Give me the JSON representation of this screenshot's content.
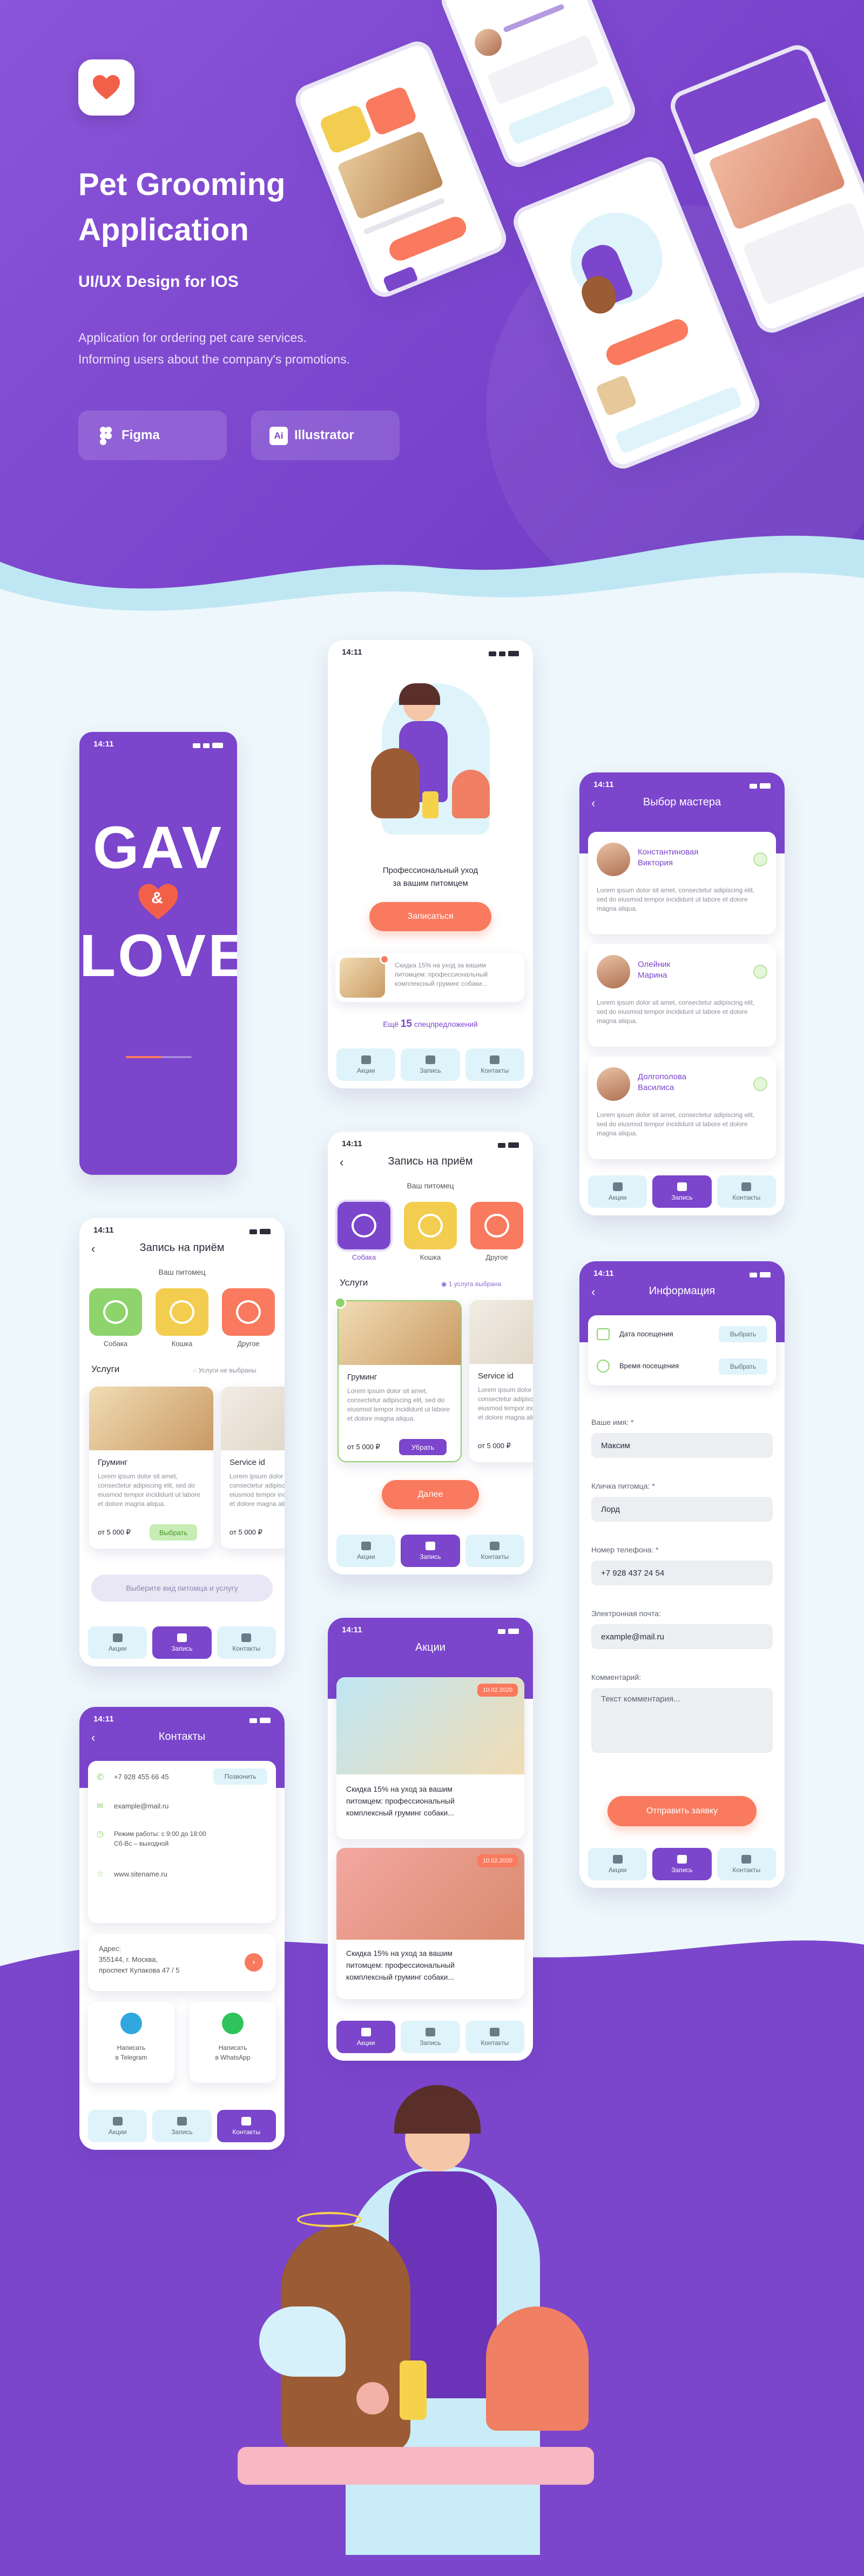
{
  "hero": {
    "title_line1": "Pet Grooming",
    "title_line2": "Application",
    "subtitle": "UI/UX Design for IOS",
    "desc_line1": "Application for ordering pet care services.",
    "desc_line2": "Informing users about the company's promotions.",
    "tools": [
      "Figma",
      "Illustrator"
    ],
    "tool_ai_badge": "Ai"
  },
  "status_time": "14:11",
  "tabs": {
    "promo": "Акции",
    "booking": "Запись",
    "contacts": "Контакты"
  },
  "splash": {
    "line1": "GAV",
    "amp": "&",
    "line2": "LOVE"
  },
  "home": {
    "caption_line1": "Профессиональный уход",
    "caption_line2": "за вашим питомцем",
    "cta": "Записаться",
    "promo_text": "Скидка 15% на уход за вашим питомцем: профессиональный комплексный груминг собаки...",
    "more_prefix": "Ещё",
    "more_count": "15",
    "more_suffix": "спецпредложений"
  },
  "master": {
    "title": "Выбор мастера",
    "lorem": "Lorem ipsum dolor sit amet, consectetur adipiscing elit, sed do eiusmod tempor incididunt ut labore et dolore magna aliqua.",
    "masters": [
      {
        "name1": "Константиновая",
        "name2": "Виктория"
      },
      {
        "name1": "Олейник",
        "name2": "Марина"
      },
      {
        "name1": "Долгополова",
        "name2": "Василиса"
      }
    ]
  },
  "booking1": {
    "title": "Запись на приём",
    "pet_label": "Ваш питомец",
    "pets": [
      "Собака",
      "Кошка",
      "Другое"
    ],
    "services": "Услуги",
    "services_hint": "Услуги не выбраны",
    "svc1": "Груминг",
    "svc2": "Service id",
    "lorem": "Lorem ipsum dolor sit amet, consectetur adipiscing elit, sed do eiusmod tempor incididunt ut labore et dolore magna aliqua.",
    "price": "от 5 000 ₽",
    "choose": "Выбрать",
    "placeholder": "Выберите вид питомца и услугу"
  },
  "booking2": {
    "title": "Запись на приём",
    "pet_label": "Ваш питомец",
    "pets": [
      "Собака",
      "Кошка",
      "Другое"
    ],
    "services": "Услуги",
    "services_hint": "1 услуга выбрана",
    "svc1": "Груминг",
    "svc2": "Service id",
    "lorem": "Lorem ipsum dolor sit amet, consectetur adipiscing elit, sed do eiusmod tempor incididunt ut labore et dolore magna aliqua.",
    "price": "от 5 000 ₽",
    "remove": "Убрать",
    "next": "Далее"
  },
  "info": {
    "title": "Информация",
    "visit_date": "Дата посещения",
    "visit_time": "Время посещения",
    "choose": "Выбрать",
    "name_label": "Ваше имя: *",
    "name_value": "Максим",
    "pet_label": "Кличка питомца: *",
    "pet_value": "Лорд",
    "phone_label": "Номер телефона: *",
    "phone_value": "+7 928 437 24 54",
    "email_label": "Электронная почта:",
    "email_value": "example@mail.ru",
    "comment_label": "Комментарий:",
    "comment_placeholder": "Текст комментария...",
    "submit": "Отправить заявку"
  },
  "contacts": {
    "title": "Контакты",
    "phone": "+7 928 455 66 45",
    "call": "Позвонить",
    "email": "example@mail.ru",
    "hours_line1": "Режим работы: с 9:00 до 18:00",
    "hours_line2": "Сб-Вс – выходной",
    "site": "www.sitename.ru",
    "addr_label": "Адрес:",
    "addr_line1": "355144, г. Москва,",
    "addr_line2": "проспект Кулакова 47 / 5",
    "tg_line1": "Написать",
    "tg_line2": "в Telegram",
    "wa_line1": "Написать",
    "wa_line2": "в WhatsApp"
  },
  "promos": {
    "title": "Акции",
    "badge": "10.02.2020",
    "text1": "Скидка 15% на уход за вашим",
    "text2": "питомцем: профессиональный",
    "text3": "комплексный груминг собаки..."
  },
  "colors": {
    "purple": "#7b45cc",
    "coral": "#f97a5e",
    "mint": "#dff3fa",
    "green": "#8ed36c",
    "yellow": "#f3cd4f"
  }
}
